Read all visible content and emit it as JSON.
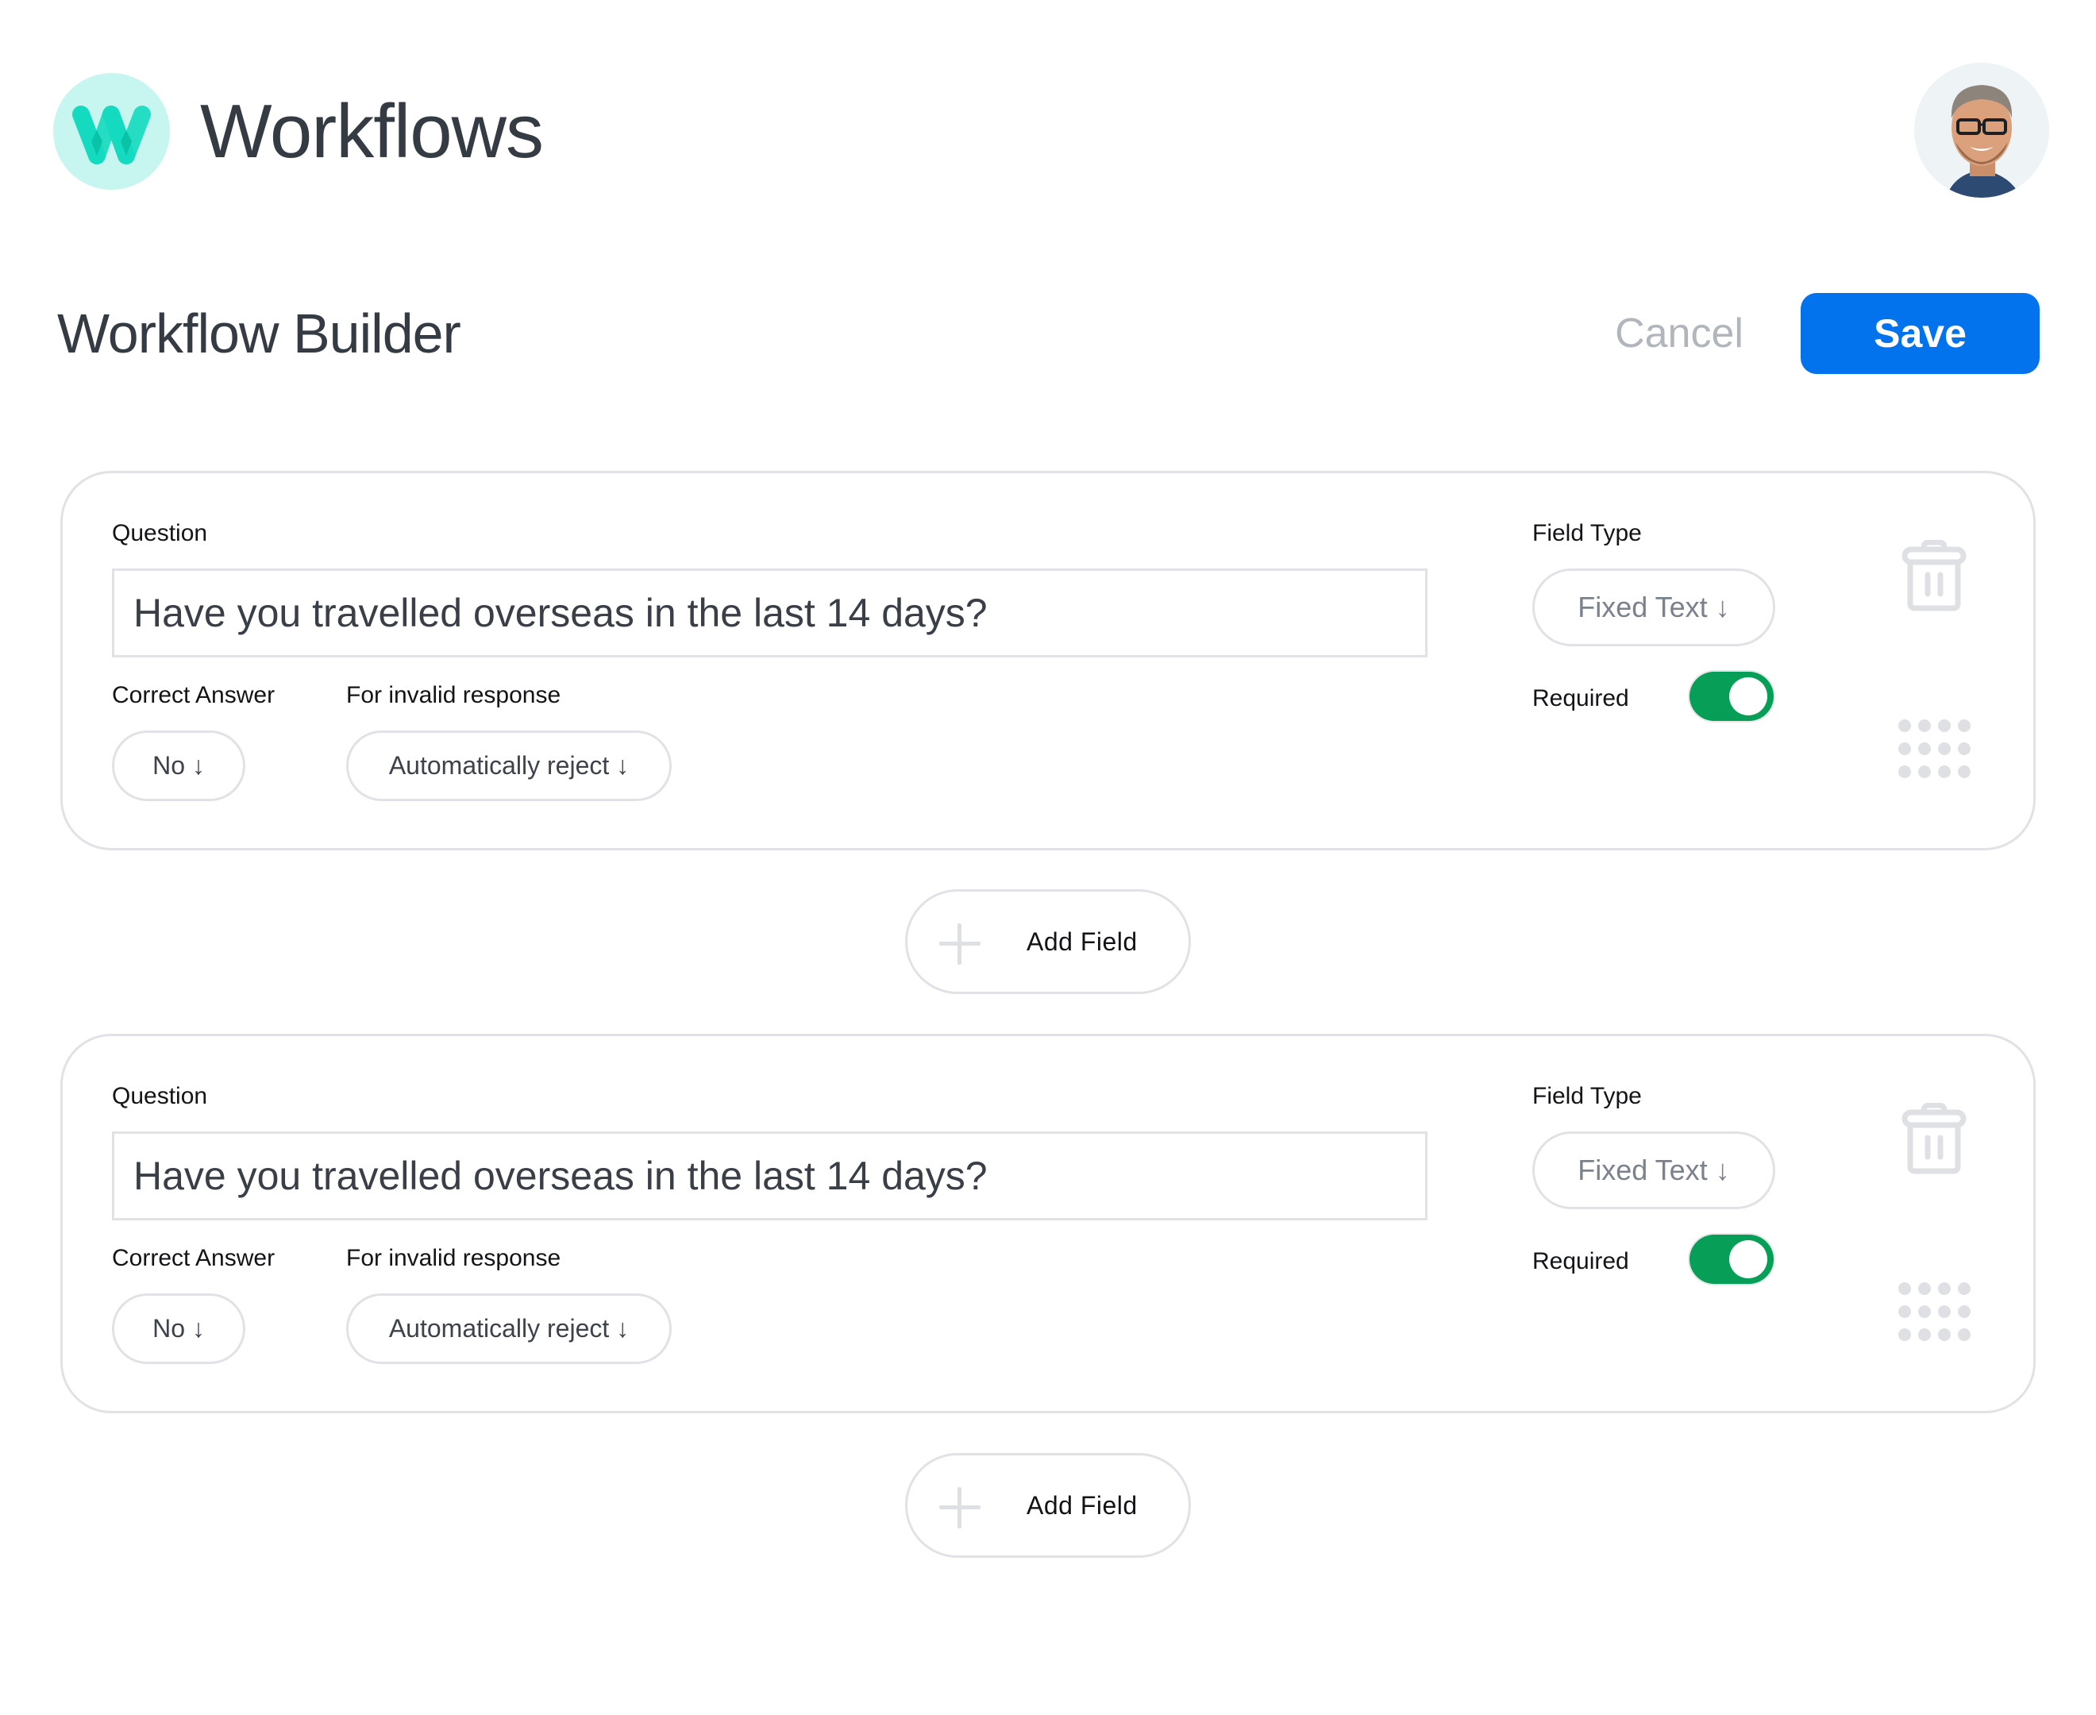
{
  "header": {
    "app_title": "Workflows",
    "logo_icon": "workflows-w-logo",
    "avatar_icon": "user-avatar-photo"
  },
  "toolbar": {
    "page_title": "Workflow Builder",
    "cancel_label": "Cancel",
    "save_label": "Save"
  },
  "colors": {
    "brand": "#14dbbf",
    "brand_light": "#c6f6ef",
    "primary": "#0273ec",
    "toggle_on": "#079f57",
    "border": "#e1e2e6"
  },
  "fields": [
    {
      "question_label": "Question",
      "question_value": "Have you travelled overseas in the last 14 days?",
      "correct_answer_label": "Correct Answer",
      "correct_answer_value": "No ↓",
      "invalid_response_label": "For invalid response",
      "invalid_response_value": "Automatically reject ↓",
      "field_type_label": "Field Type",
      "field_type_value": "Fixed Text ↓",
      "required_label": "Required",
      "required": true,
      "delete_icon": "trash-icon",
      "drag_icon": "drag-handle-icon"
    },
    {
      "question_label": "Question",
      "question_value": "Have you travelled overseas in the last 14 days?",
      "correct_answer_label": "Correct Answer",
      "correct_answer_value": "No ↓",
      "invalid_response_label": "For invalid response",
      "invalid_response_value": "Automatically reject ↓",
      "field_type_label": "Field Type",
      "field_type_value": "Fixed Text ↓",
      "required_label": "Required",
      "required": true,
      "delete_icon": "trash-icon",
      "drag_icon": "drag-handle-icon"
    }
  ],
  "add_field": {
    "label": "Add Field",
    "icon": "plus-icon"
  }
}
